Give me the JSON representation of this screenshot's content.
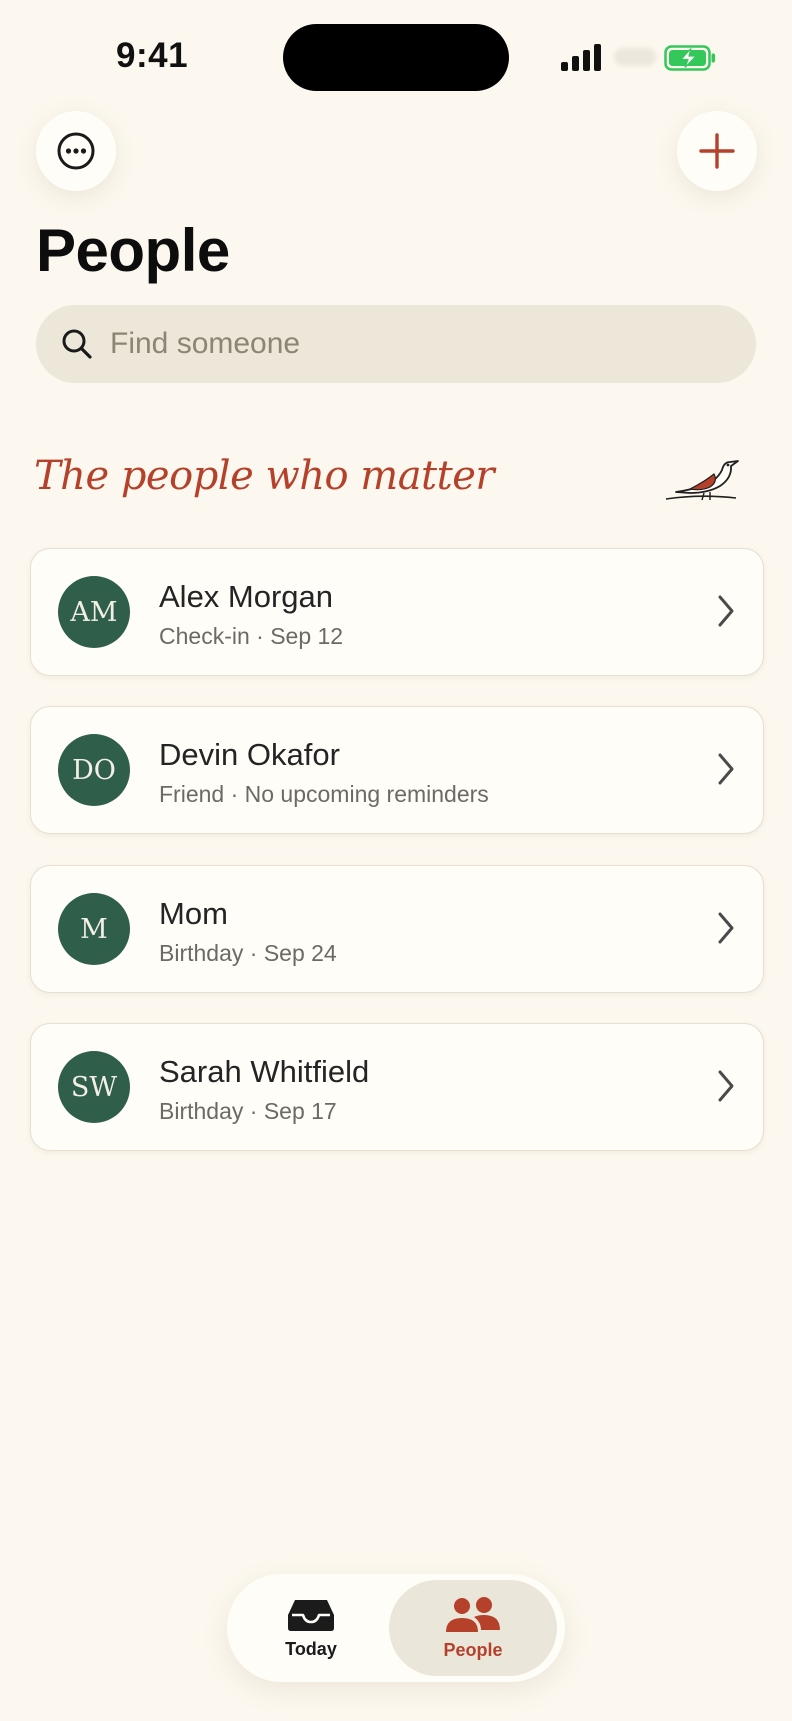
{
  "status_bar": {
    "time": "9:41"
  },
  "header": {
    "title": "People",
    "more_icon": "ellipsis-circle-icon",
    "add_icon": "plus-icon"
  },
  "search": {
    "placeholder": "Find someone",
    "value": "",
    "icon": "magnifier-icon"
  },
  "section": {
    "tagline": "The people who matter",
    "illustration": "bird-icon"
  },
  "people": [
    {
      "initials": "AM",
      "name": "Alex Morgan",
      "detail": "Check-in · Sep 12"
    },
    {
      "initials": "DO",
      "name": "Devin Okafor",
      "detail": "Friend · No upcoming reminders"
    },
    {
      "initials": "M",
      "name": "Mom",
      "detail": "Birthday · Sep 24"
    },
    {
      "initials": "SW",
      "name": "Sarah Whitfield",
      "detail": "Birthday · Sep 17"
    }
  ],
  "tabbar": {
    "tabs": [
      {
        "label": "Today",
        "icon": "inbox-tray-icon",
        "selected": false
      },
      {
        "label": "People",
        "icon": "people-icon",
        "selected": true
      }
    ]
  },
  "colors": {
    "background": "#fcf8ef",
    "accent": "#b5412b",
    "avatar": "#2f5e4b",
    "battery": "#34c759"
  }
}
